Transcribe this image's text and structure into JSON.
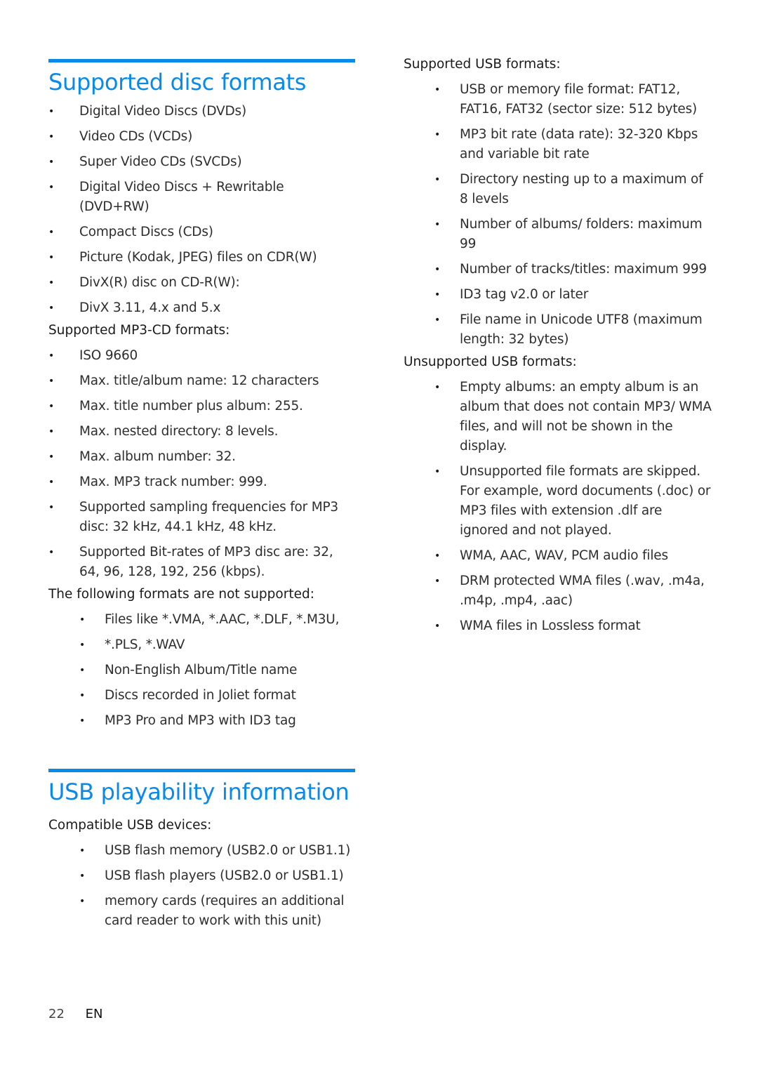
{
  "sections": {
    "disc": {
      "title": "Supported disc formats",
      "items": [
        "Digital Video Discs (DVDs)",
        "Video CDs (VCDs)",
        "Super Video CDs (SVCDs)",
        "Digital Video Discs + Rewritable (DVD+RW)",
        "Compact Discs (CDs)",
        "Picture (Kodak, JPEG) files on CDR(W)",
        "DivX(R) disc on CD-R(W):",
        "DivX 3.11, 4.x and 5.x"
      ],
      "mp3cd_heading": "Supported MP3-CD formats:",
      "mp3cd_items": [
        "ISO 9660",
        "Max. title/album name: 12 characters",
        "Max. title number plus album: 255.",
        "Max. nested directory: 8 levels.",
        "Max. album number: 32.",
        "Max. MP3 track number: 999.",
        "Supported sampling frequencies for MP3 disc: 32 kHz, 44.1 kHz, 48 kHz.",
        "Supported Bit-rates of MP3 disc are: 32, 64, 96, 128, 192, 256 (kbps)."
      ],
      "not_supported_heading": "The following formats are not supported:",
      "not_supported_items": [
        "Files like *.VMA, *.AAC, *.DLF, *.M3U,",
        "*.PLS, *.WAV",
        "Non-English Album/Title name",
        "Discs recorded in Joliet format",
        "MP3 Pro and MP3 with ID3 tag"
      ]
    },
    "usb": {
      "title": "USB playability information",
      "compatible_heading": "Compatible USB devices:",
      "compatible_items": [
        "USB flash memory (USB2.0 or USB1.1)",
        "USB flash players (USB2.0 or USB1.1)",
        "memory cards (requires an additional card reader to work with this unit)"
      ],
      "supported_heading": "Supported USB formats:",
      "supported_items": [
        "USB or memory file format: FAT12, FAT16, FAT32 (sector size: 512 bytes)",
        "MP3 bit rate (data rate): 32-320 Kbps and variable bit rate",
        "Directory nesting up to a maximum of 8 levels",
        "Number of albums/ folders: maximum 99",
        "Number of tracks/titles: maximum 999",
        "ID3 tag v2.0 or later",
        "File name in Unicode UTF8 (maximum length: 32 bytes)"
      ],
      "unsupported_heading": "Unsupported USB formats:",
      "unsupported_items": [
        "Empty albums: an empty album is an album that does not contain MP3/ WMA files, and will not be shown in the display.",
        "Unsupported file formats are skipped. For example, word documents (.doc) or MP3 files with extension .dlf are ignored and not played.",
        "WMA, AAC, WAV, PCM audio files",
        "DRM protected WMA files (.wav, .m4a, .m4p, .mp4, .aac)",
        "WMA files in Lossless format"
      ]
    }
  },
  "footer": {
    "page_number": "22",
    "language": "EN"
  },
  "colors": {
    "accent": "#0a8ae8",
    "text": "#2e2e2e"
  },
  "bullet_glyph": "•"
}
